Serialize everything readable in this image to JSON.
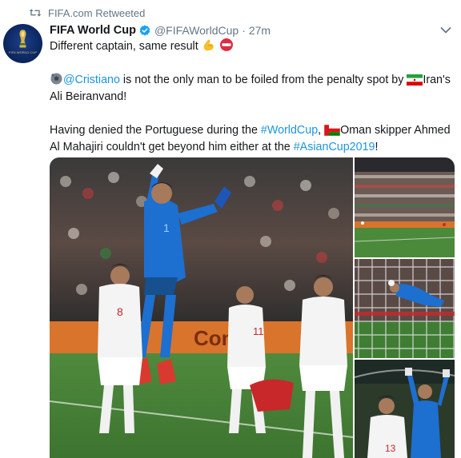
{
  "retweet": {
    "icon": "retweet-icon",
    "text": "FIFA.com Retweeted"
  },
  "author": {
    "avatar_icon": "fifa-world-cup-logo",
    "display_name": "FIFA World Cup",
    "verified_icon": "verified-badge-icon",
    "handle": "@FIFAWorldCup",
    "separator": "·",
    "time": "27m"
  },
  "tweet": {
    "line1_text": "Different captain, same result",
    "line1_emojis": [
      "flexed-biceps-emoji",
      "no-entry-emoji"
    ],
    "line2_emoji": "soccer-ball-emoji",
    "line2_mention": "@Cristiano",
    "line2_text": " is not the only man to be foiled from the penalty spot by ",
    "line2_flag": "iran-flag-emoji",
    "line2_end": "Iran's",
    "line3": "Ali Beiranvand!",
    "line4_start": "Having denied the Portuguese during the ",
    "line4_hashtag": "#WorldCup",
    "line4_sep": ", ",
    "line4_flag": "oman-flag-emoji",
    "line4_end": "Oman skipper Ahmed",
    "line5_start": "Al Mahajiri couldn't get beyond him either at the ",
    "line5_hashtag": "#AsianCup2019",
    "line5_end": "!"
  },
  "media": {
    "main_photo": {
      "subject": "goalkeeper-celebrating-photo",
      "board_text": "Conti",
      "jersey_numbers": [
        "8",
        "1",
        "11"
      ]
    },
    "top_right_photo": {
      "subject": "stadium-crowd-photo"
    },
    "middle_right_photo": {
      "subject": "goalkeeper-diving-save-photo"
    },
    "bottom_right_photo": {
      "subject": "players-celebrating-photo",
      "jersey_numbers": [
        "13"
      ]
    }
  },
  "colors": {
    "link": "#1b95e0",
    "secondary_text": "#657786",
    "verified": "#1da1f2",
    "iran_red": "#cc2a2a",
    "keeper_blue": "#1d6fd0"
  }
}
